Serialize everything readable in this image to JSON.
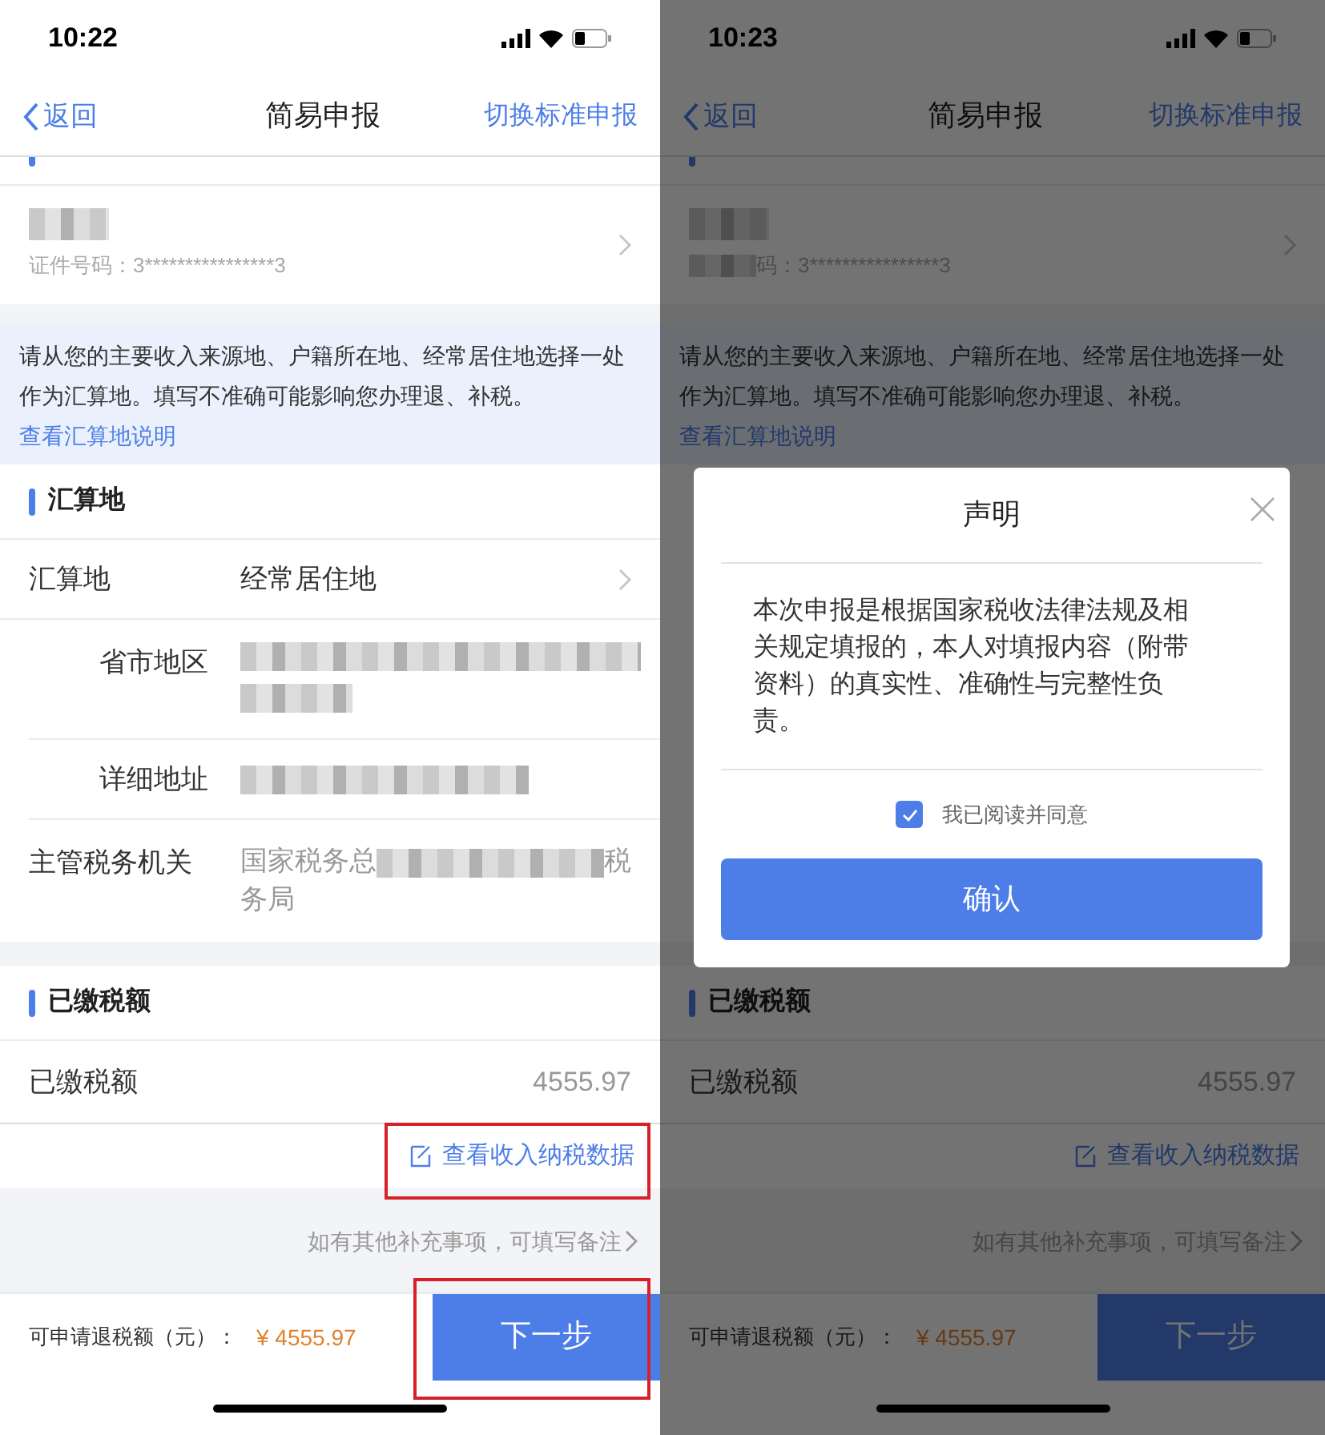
{
  "phones": [
    {
      "status_time": "10:22",
      "nav": {
        "back": "返回",
        "title": "简易申报",
        "action": "切换标准申报"
      },
      "person": {
        "id_text": "证件号码：3****************3",
        "id_blur_prefix": false
      },
      "notice": {
        "text": "请从您的主要收入来源地、户籍所在地、经常居住地选择一处作为汇算地。填写不准确可能影响您办理退、补税。",
        "link": "查看汇算地说明"
      },
      "section": {
        "header": "汇算地",
        "rows": [
          {
            "kind": "select",
            "label": "汇算地",
            "value": "经常居住地"
          },
          {
            "kind": "region",
            "label": "省市地区"
          },
          {
            "kind": "address",
            "label": "详细地址"
          },
          {
            "kind": "partial",
            "label": "主管税务机关",
            "parts": [
              "国家税务总",
              "税务局"
            ]
          }
        ]
      },
      "paid": {
        "header": "已缴税额",
        "label": "已缴税额",
        "value": "4555.97"
      },
      "data_link": {
        "label": "查看收入纳税数据",
        "highlighted": true
      },
      "remark": "如有其他补充事项，可填写备注",
      "footer": {
        "label": "可申请退税额（元）：",
        "amount": "¥ 4555.97",
        "next": {
          "label": "下一步",
          "highlighted": true
        }
      }
    },
    {
      "status_time": "10:23",
      "nav": {
        "back": "返回",
        "title": "简易申报",
        "action": "切换标准申报"
      },
      "person": {
        "id_text": "码：3****************3",
        "id_blur_prefix": true
      },
      "notice": {
        "text": "请从您的主要收入来源地、户籍所在地、经常居住地选择一处作为汇算地。填写不准确可能影响您办理退、补税。",
        "link": "查看汇算地说明"
      },
      "paid": {
        "header": "已缴税额",
        "label": "已缴税额",
        "value": "4555.97"
      },
      "data_link": {
        "label": "查看收入纳税数据",
        "highlighted": false
      },
      "remark": "如有其他补充事项，可填写备注",
      "footer": {
        "label": "可申请退税额（元）：",
        "amount": "¥ 4555.97",
        "next": {
          "label": "下一步",
          "highlighted": false
        }
      },
      "dialog": {
        "title": "声明",
        "body": "本次申报是根据国家税收法律法规及相关规定填报的，本人对填报内容（附带资料）的真实性、准确性与完整性负责。",
        "agree": {
          "label": "我已阅读并同意",
          "checked": true
        },
        "confirm": "确认"
      }
    }
  ]
}
